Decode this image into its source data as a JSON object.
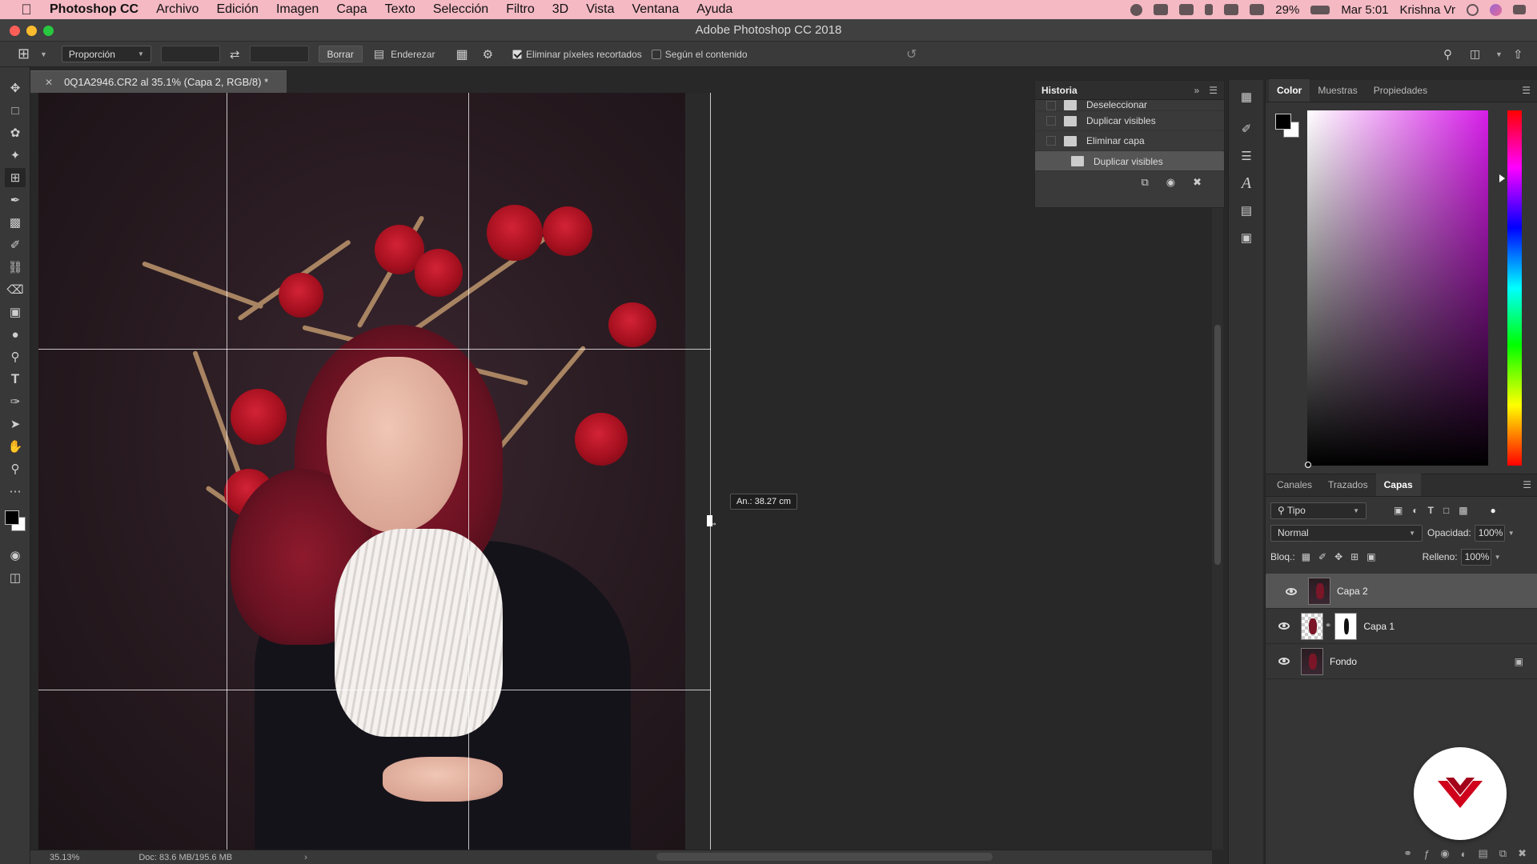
{
  "menubar": {
    "app": "Photoshop CC",
    "items": [
      "Archivo",
      "Edición",
      "Imagen",
      "Capa",
      "Texto",
      "Selección",
      "Filtro",
      "3D",
      "Vista",
      "Ventana",
      "Ayuda"
    ],
    "battery": "29%",
    "clock": "Mar 5:01",
    "user": "Krishna Vr"
  },
  "window": {
    "title": "Adobe Photoshop CC 2018"
  },
  "options": {
    "ratio_select": "Proporción",
    "clear_button": "Borrar",
    "straighten": "Enderezar",
    "delete_pixels": "Eliminar píxeles recortados",
    "content_aware": "Según el contenido"
  },
  "document": {
    "tab": "0Q1A2946.CR2 al 35.1% (Capa 2, RGB/8) *",
    "tooltip": "An.: 38.27 cm",
    "zoom": "35.13%",
    "doc_info": "Doc: 83.6 MB/195.6 MB"
  },
  "history": {
    "title": "Historia",
    "items": [
      "Deseleccionar",
      "Duplicar visibles",
      "Eliminar capa",
      "Duplicar visibles"
    ]
  },
  "color_panel": {
    "tabs": [
      "Color",
      "Muestras",
      "Propiedades"
    ],
    "hue": "#d61de8"
  },
  "layers_panel": {
    "tabs": [
      "Canales",
      "Trazados",
      "Capas"
    ],
    "filter": "Tipo",
    "blend": "Normal",
    "opacity_label": "Opacidad:",
    "opacity": "100%",
    "lock_label": "Bloq.:",
    "fill_label": "Relleno:",
    "fill": "100%",
    "layers": [
      "Capa 2",
      "Capa 1",
      "Fondo"
    ]
  },
  "colors": {
    "menubar": "#f4b9c3",
    "accent": "#d0021b"
  }
}
